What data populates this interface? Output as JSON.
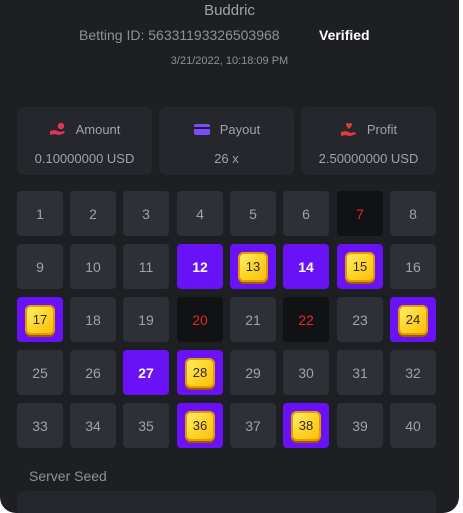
{
  "bet": {
    "username": "Buddric",
    "betting_id": "Betting ID: 56331193326503968",
    "status": "Verified",
    "timestamp": "3/21/2022, 10:18:09 PM"
  },
  "stats": [
    {
      "label": "Amount",
      "value": "0.10000000 USD",
      "icon": "hand-coin-icon",
      "color": "#e6335a"
    },
    {
      "label": "Payout",
      "value": "26 x",
      "icon": "card-icon",
      "color": "#7d4cff"
    },
    {
      "label": "Profit",
      "value": "2.50000000 USD",
      "icon": "hand-heart-icon",
      "color": "#ea3b3b"
    }
  ],
  "grid": {
    "numbers": [
      "1",
      "2",
      "3",
      "4",
      "5",
      "6",
      "7",
      "8",
      "9",
      "10",
      "11",
      "12",
      "13",
      "14",
      "15",
      "16",
      "17",
      "18",
      "19",
      "20",
      "21",
      "22",
      "23",
      "24",
      "25",
      "26",
      "27",
      "28",
      "29",
      "30",
      "31",
      "32",
      "33",
      "34",
      "35",
      "36",
      "37",
      "38",
      "39",
      "40"
    ],
    "selected_only": [
      12,
      14,
      27
    ],
    "drawn_only": [
      7,
      20,
      22
    ],
    "hits": [
      13,
      15,
      17,
      24,
      28,
      36,
      38
    ]
  },
  "server_seed": {
    "label": "Server Seed"
  },
  "colors": {
    "panel_bg": "#1e1f23",
    "tile_bg": "#2e3037",
    "selected": "#6a12f7",
    "drawn_bg": "#111214",
    "drawn_text": "#e2262d",
    "gem": "#ffd82e"
  }
}
